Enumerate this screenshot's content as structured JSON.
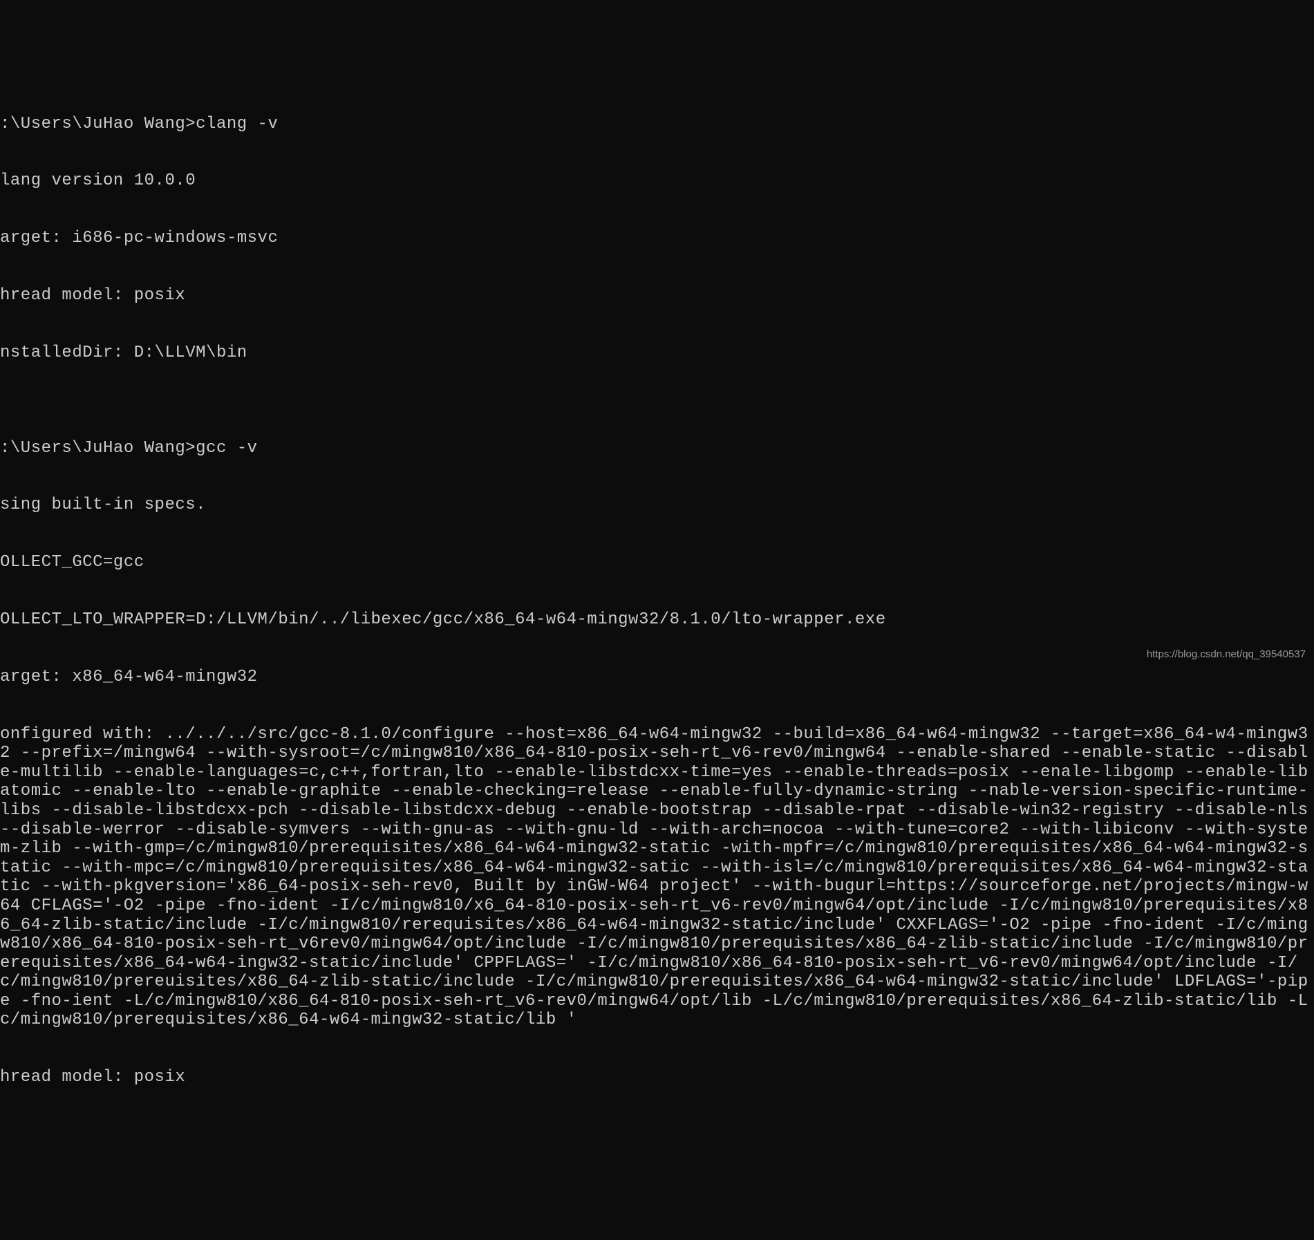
{
  "terminal": {
    "lines": [
      ":\\Users\\JuHao Wang>clang -v",
      "lang version 10.0.0",
      "arget: i686-pc-windows-msvc",
      "hread model: posix",
      "nstalledDir: D:\\LLVM\\bin",
      "",
      ":\\Users\\JuHao Wang>gcc -v",
      "sing built-in specs.",
      "OLLECT_GCC=gcc",
      "OLLECT_LTO_WRAPPER=D:/LLVM/bin/../libexec/gcc/x86_64-w64-mingw32/8.1.0/lto-wrapper.exe",
      "arget: x86_64-w64-mingw32",
      "onfigured with: ../../../src/gcc-8.1.0/configure --host=x86_64-w64-mingw32 --build=x86_64-w64-mingw32 --target=x86_64-w4-mingw32 --prefix=/mingw64 --with-sysroot=/c/mingw810/x86_64-810-posix-seh-rt_v6-rev0/mingw64 --enable-shared --enable-static --disable-multilib --enable-languages=c,c++,fortran,lto --enable-libstdcxx-time=yes --enable-threads=posix --enale-libgomp --enable-libatomic --enable-lto --enable-graphite --enable-checking=release --enable-fully-dynamic-string --nable-version-specific-runtime-libs --disable-libstdcxx-pch --disable-libstdcxx-debug --enable-bootstrap --disable-rpat --disable-win32-registry --disable-nls --disable-werror --disable-symvers --with-gnu-as --with-gnu-ld --with-arch=nocoa --with-tune=core2 --with-libiconv --with-system-zlib --with-gmp=/c/mingw810/prerequisites/x86_64-w64-mingw32-static -with-mpfr=/c/mingw810/prerequisites/x86_64-w64-mingw32-static --with-mpc=/c/mingw810/prerequisites/x86_64-w64-mingw32-satic --with-isl=/c/mingw810/prerequisites/x86_64-w64-mingw32-static --with-pkgversion='x86_64-posix-seh-rev0, Built by inGW-W64 project' --with-bugurl=https://sourceforge.net/projects/mingw-w64 CFLAGS='-O2 -pipe -fno-ident -I/c/mingw810/x6_64-810-posix-seh-rt_v6-rev0/mingw64/opt/include -I/c/mingw810/prerequisites/x86_64-zlib-static/include -I/c/mingw810/rerequisites/x86_64-w64-mingw32-static/include' CXXFLAGS='-O2 -pipe -fno-ident -I/c/mingw810/x86_64-810-posix-seh-rt_v6rev0/mingw64/opt/include -I/c/mingw810/prerequisites/x86_64-zlib-static/include -I/c/mingw810/prerequisites/x86_64-w64-ingw32-static/include' CPPFLAGS=' -I/c/mingw810/x86_64-810-posix-seh-rt_v6-rev0/mingw64/opt/include -I/c/mingw810/prereuisites/x86_64-zlib-static/include -I/c/mingw810/prerequisites/x86_64-w64-mingw32-static/include' LDFLAGS='-pipe -fno-ient -L/c/mingw810/x86_64-810-posix-seh-rt_v6-rev0/mingw64/opt/lib -L/c/mingw810/prerequisites/x86_64-zlib-static/lib -Lc/mingw810/prerequisites/x86_64-w64-mingw32-static/lib '",
      "hread model: posix"
    ]
  },
  "watermark": "https://blog.csdn.net/qq_39540537"
}
